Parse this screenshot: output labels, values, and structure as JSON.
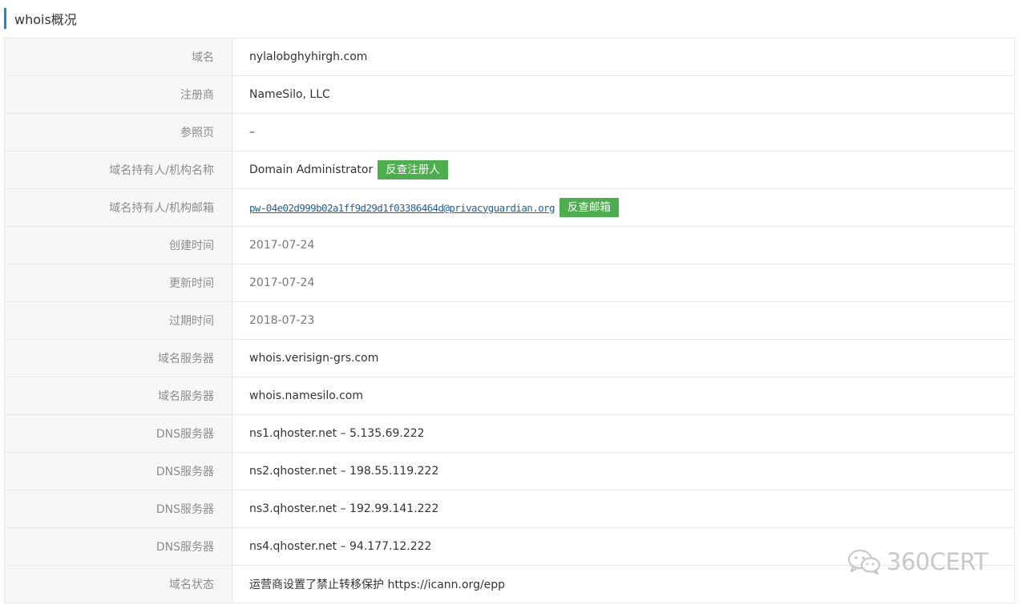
{
  "header": {
    "title": "whois概况"
  },
  "rows": [
    {
      "label": "域名",
      "value": "nylalobghyhirgh.com"
    },
    {
      "label": "注册商",
      "value": "NameSilo, LLC"
    },
    {
      "label": "参照页",
      "value": "–"
    },
    {
      "label": "域名持有人/机构名称",
      "value": "Domain Administrator",
      "button": "反查注册人"
    },
    {
      "label": "域名持有人/机构邮箱",
      "value": "pw-04e02d999b02a1ff9d29d1f03386464d@privacyguardian.org",
      "button": "反查邮箱"
    },
    {
      "label": "创建时间",
      "value": "2017-07-24"
    },
    {
      "label": "更新时间",
      "value": "2017-07-24"
    },
    {
      "label": "过期时间",
      "value": "2018-07-23"
    },
    {
      "label": "域名服务器",
      "value": "whois.verisign-grs.com"
    },
    {
      "label": "域名服务器",
      "value": "whois.namesilo.com"
    },
    {
      "label": "DNS服务器",
      "value": "ns1.qhoster.net – 5.135.69.222"
    },
    {
      "label": "DNS服务器",
      "value": "ns2.qhoster.net – 198.55.119.222"
    },
    {
      "label": "DNS服务器",
      "value": "ns3.qhoster.net – 192.99.141.222"
    },
    {
      "label": "DNS服务器",
      "value": "ns4.qhoster.net – 94.177.12.222"
    },
    {
      "label": "域名状态",
      "value": "运营商设置了禁止转移保护 https://icann.org/epp"
    }
  ],
  "watermark": {
    "text": "360CERT",
    "icon": "wechat-icon"
  },
  "colors": {
    "accent": "#1e88c7",
    "button": "#4cae4c",
    "link": "#1e5fa8"
  }
}
